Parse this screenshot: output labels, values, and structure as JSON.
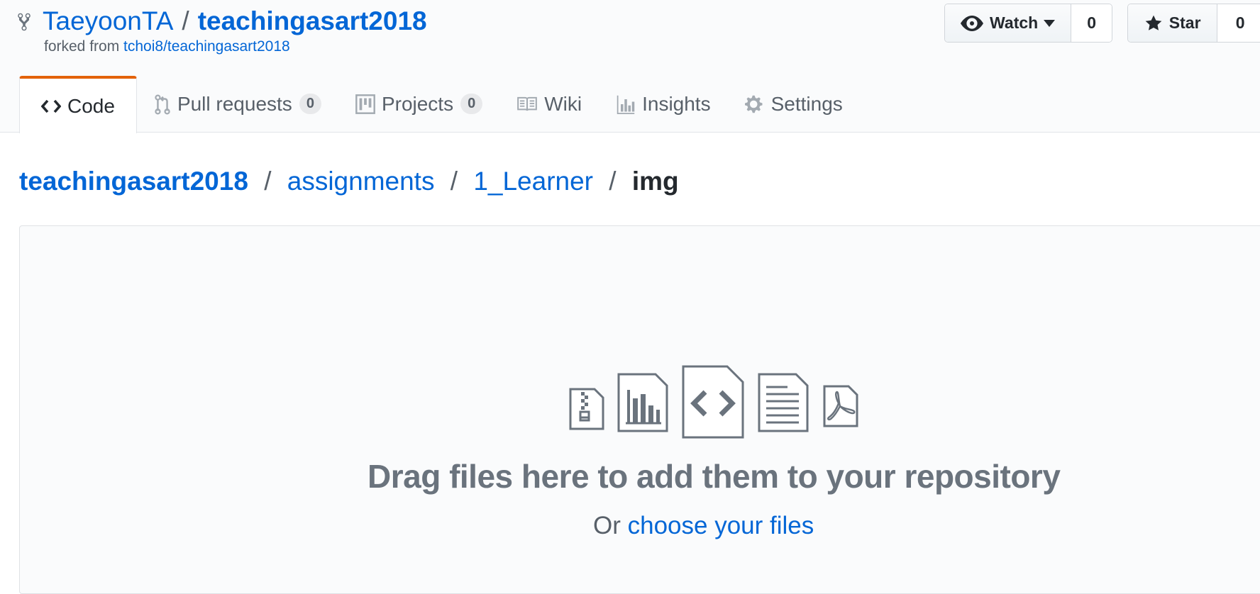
{
  "repo": {
    "owner": "TaeyoonTA",
    "separator": "/",
    "name": "teachingasart2018",
    "forked_from_prefix": "forked from",
    "forked_from_link": "tchoi8/teachingasart2018"
  },
  "actions": {
    "watch_label": "Watch",
    "watch_count": "0",
    "star_label": "Star",
    "star_count": "0"
  },
  "tabs": [
    {
      "label": "Code",
      "icon": "code-icon",
      "selected": true
    },
    {
      "label": "Pull requests",
      "icon": "git-pull-request-icon",
      "counter": "0"
    },
    {
      "label": "Projects",
      "icon": "project-icon",
      "counter": "0"
    },
    {
      "label": "Wiki",
      "icon": "book-icon"
    },
    {
      "label": "Insights",
      "icon": "graph-icon"
    },
    {
      "label": "Settings",
      "icon": "gear-icon"
    }
  ],
  "breadcrumb": {
    "root": "teachingasart2018",
    "sep": "/",
    "items": [
      "assignments",
      "1_Learner"
    ],
    "current": "img"
  },
  "dropzone": {
    "icons": [
      "file-zip-icon",
      "graph-file-icon",
      "file-code-icon",
      "file-text-icon",
      "file-pdf-icon"
    ],
    "title": "Drag files here to add them to your repository",
    "sub_prefix": "Or",
    "sub_link": "choose your files"
  },
  "colors": {
    "link": "#0366d6",
    "selected_tab_accent": "#e36209",
    "muted": "#586069"
  }
}
